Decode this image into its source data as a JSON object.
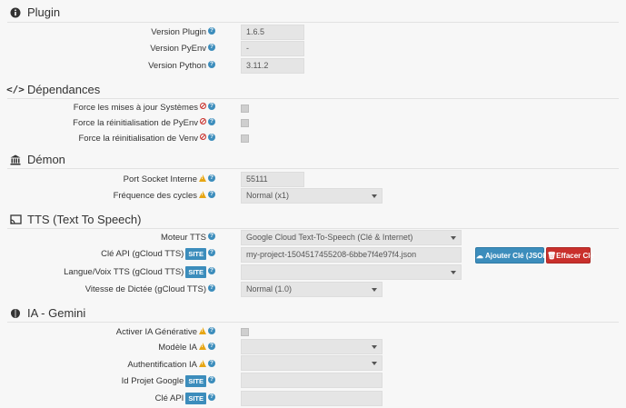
{
  "sections": {
    "plugin": "Plugin",
    "dependances": "Dépendances",
    "demon": "Démon",
    "tts": "TTS (Text To Speech)",
    "ia": "IA - Gemini"
  },
  "plugin": {
    "version_plugin_label": "Version Plugin",
    "version_plugin_value": "1.6.5",
    "version_pyenv_label": "Version PyEnv",
    "version_pyenv_value": "-",
    "version_python_label": "Version Python",
    "version_python_value": "3.11.2"
  },
  "dependances": {
    "force_maj_label": "Force les mises à jour Systèmes",
    "force_pyenv_label": "Force la réinitialisation de PyEnv",
    "force_venv_label": "Force la réinitialisation de Venv"
  },
  "demon": {
    "port_label": "Port Socket Interne",
    "port_value": "55111",
    "freq_label": "Fréquence des cycles",
    "freq_value": "Normal (x1)"
  },
  "tts": {
    "moteur_label": "Moteur TTS",
    "moteur_value": "Google Cloud Text-To-Speech (Clé & Internet)",
    "cle_label": "Clé API (gCloud TTS)",
    "cle_value": "my-project-1504517455208-6bbe7f4e97f4.json",
    "langue_label": "Langue/Voix TTS (gCloud TTS)",
    "langue_value": "",
    "vitesse_label": "Vitesse de Dictée (gCloud TTS)",
    "vitesse_value": "Normal (1.0)",
    "site_badge": "SITE",
    "add_key_button": "Ajouter Clé (JSON)",
    "delete_key_button": "Effacer Clé"
  },
  "ia": {
    "activer_label": "Activer IA Générative",
    "modele_label": "Modèle IA",
    "modele_value": "",
    "auth_label": "Authentification IA",
    "auth_value": "",
    "projet_label": "Id Projet Google",
    "projet_value": "",
    "cle_label": "Clé API",
    "cle_value": ""
  },
  "help_glyph": "?"
}
